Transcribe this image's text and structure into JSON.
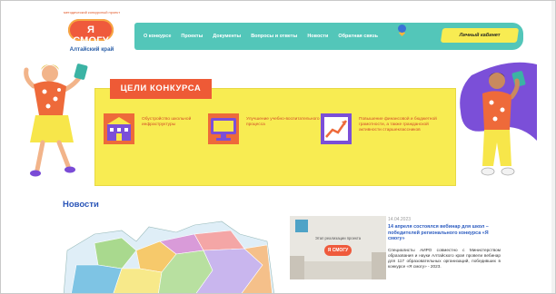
{
  "logo": {
    "slogan": "методический конкурсный проект",
    "name": "Я СМОГУ",
    "region": "Алтайский край"
  },
  "nav": {
    "items": [
      "О конкурсе",
      "Проекты",
      "Документы",
      "Вопросы и ответы",
      "Новости",
      "Обратная связь"
    ],
    "cabinet_label": "Личный кабинет"
  },
  "goals": {
    "title": "ЦЕЛИ КОНКУРСА",
    "items": [
      {
        "icon": "school-building-icon",
        "text": "Обустройство школьной инфраструктуры"
      },
      {
        "icon": "monitor-icon",
        "text": "Улучшение учебно-воспитательного процесса"
      },
      {
        "icon": "growth-chart-icon",
        "text": "Повышение финансовой и бюджетной грамотности, а также гражданской активности старшеклассников"
      }
    ]
  },
  "news": {
    "section_title": "Новости",
    "item": {
      "image_label": "Этап реализации проекта",
      "image_badge": "Я СМОГУ",
      "date": "14.04.2023",
      "headline": "14 апреля состоялся вебинар для школ – победителей регионального конкурса «Я смогу»",
      "body": "Специалисты АИРО совместно с Министерством образования и науки Алтайского края провели вебинар для 117 образовательных организаций, победивших в конкурсе «Я смогу» - 2023."
    }
  },
  "colors": {
    "nav": "#53c6b9",
    "accent": "#ee5a36",
    "panel": "#f8ec52",
    "link": "#2a55b8"
  }
}
